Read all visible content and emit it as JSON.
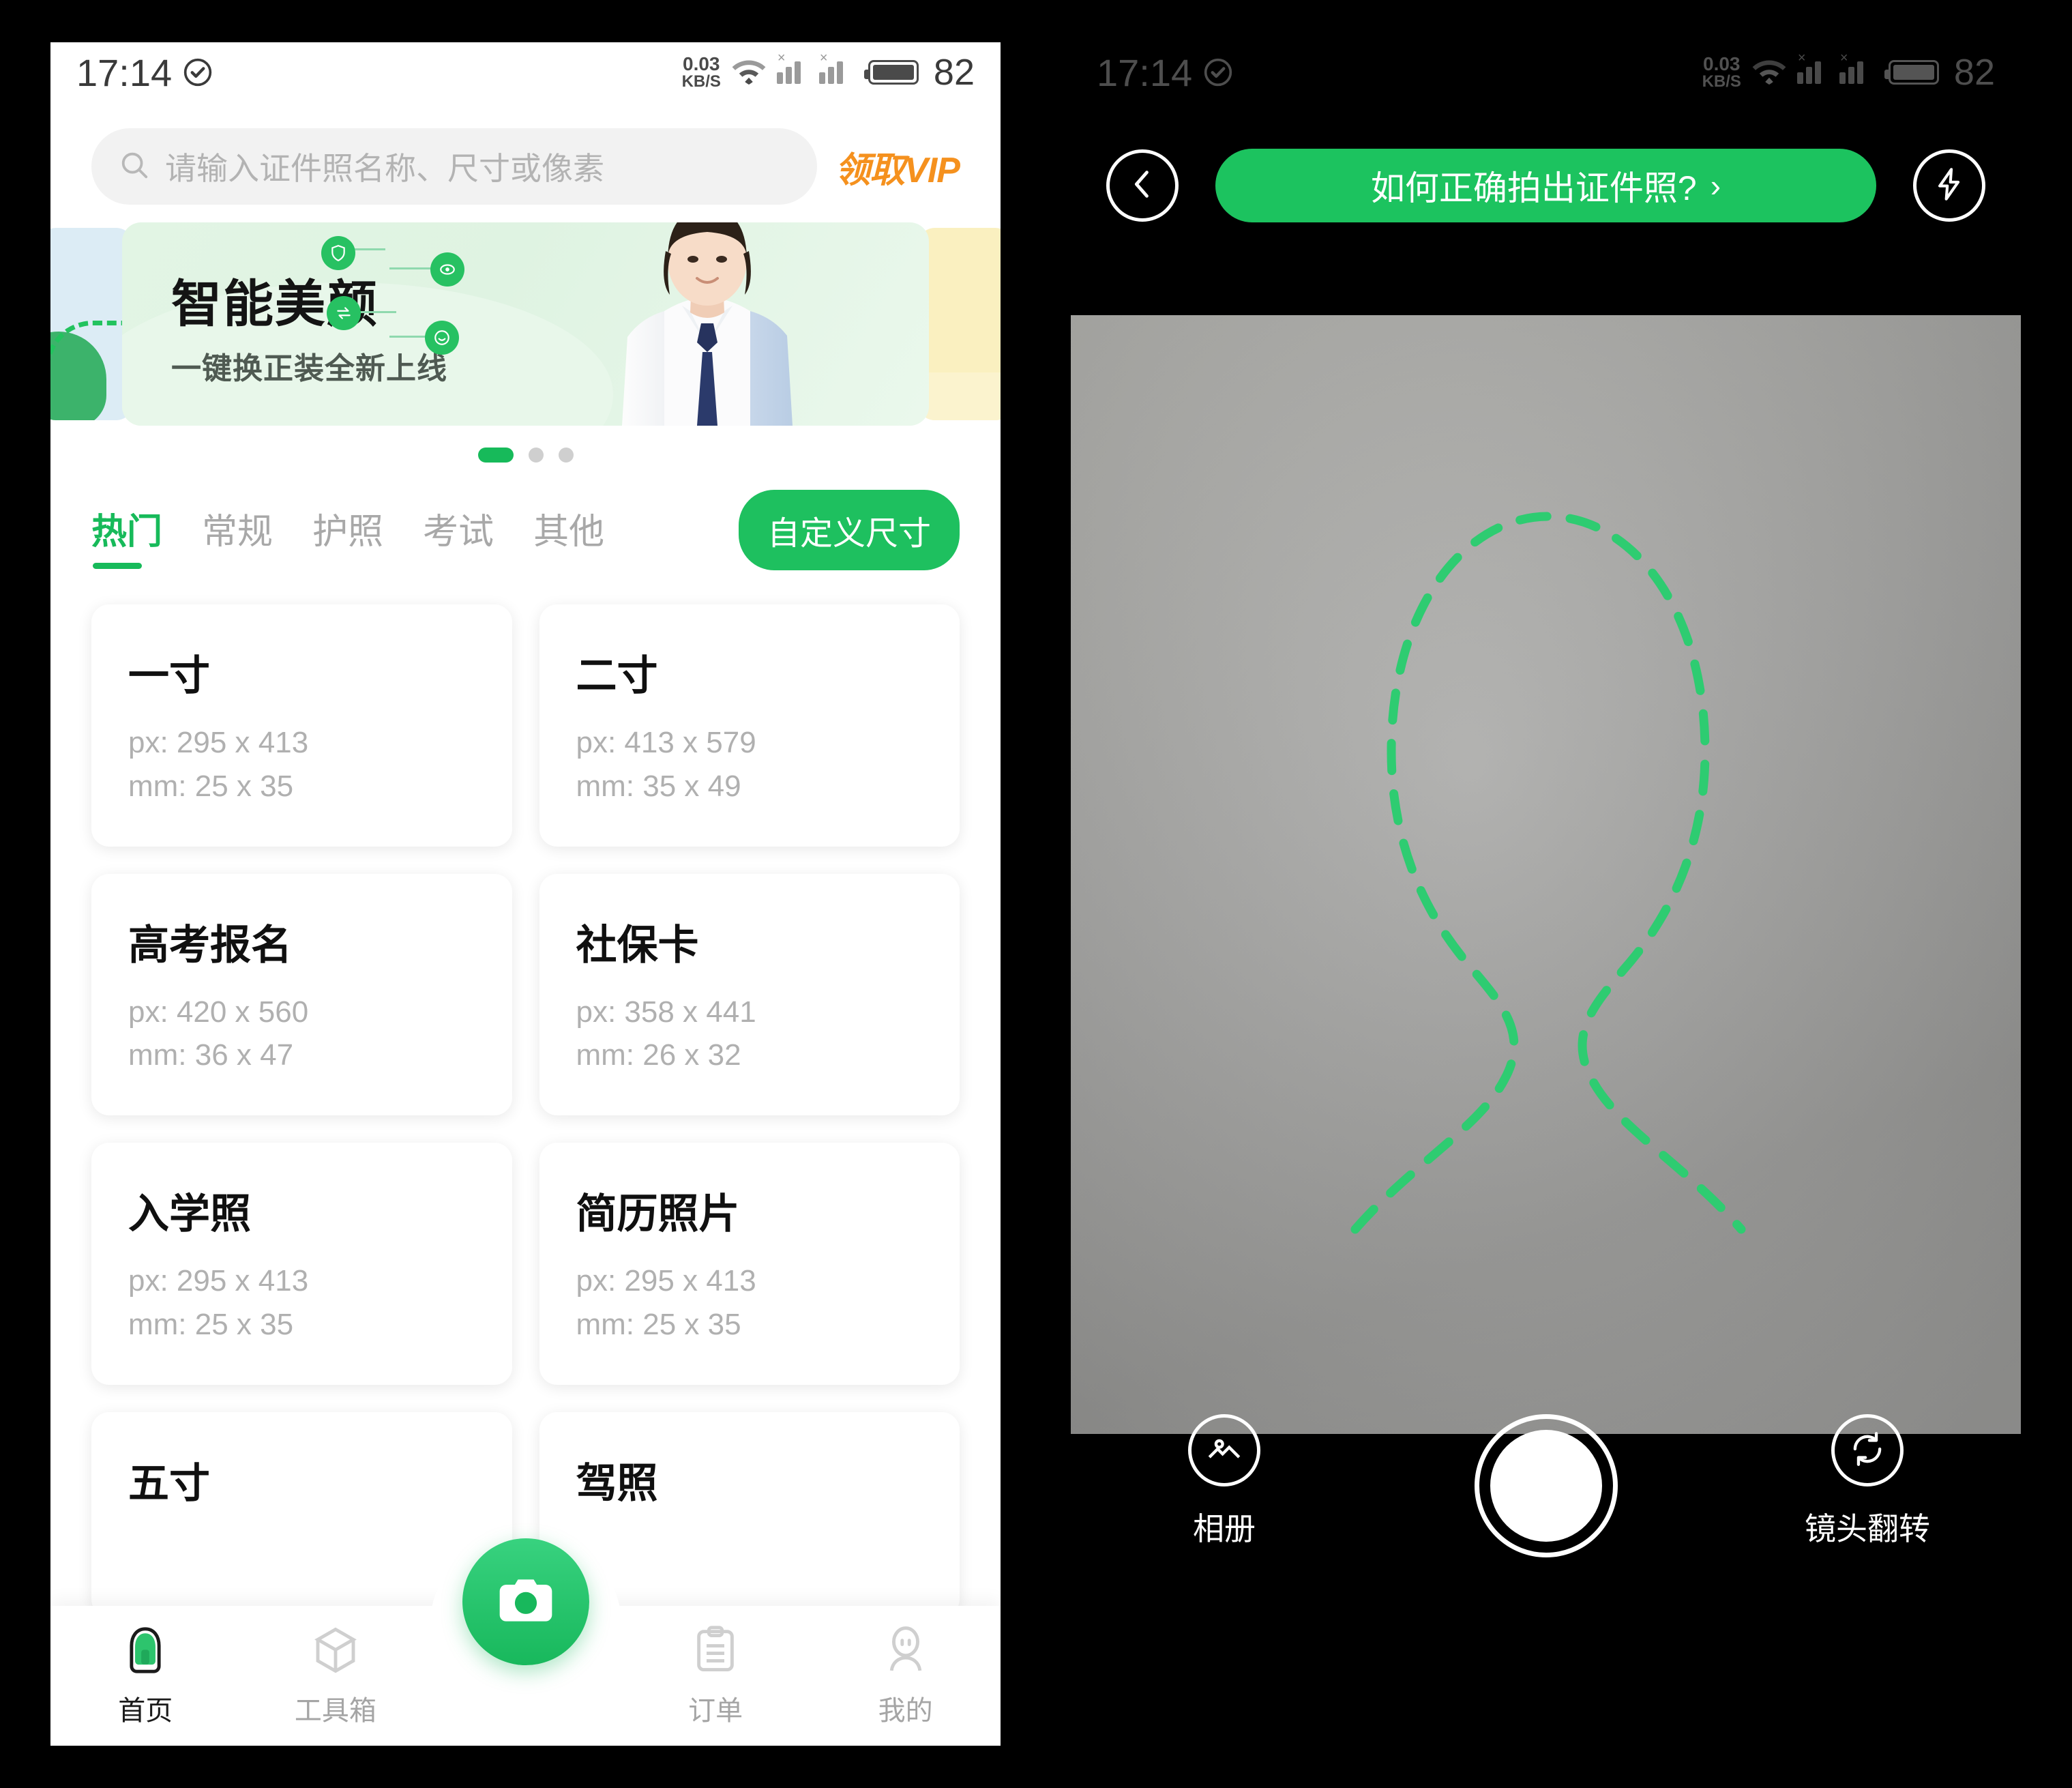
{
  "status_bar": {
    "time": "17:14",
    "net_speed_value": "0.03",
    "net_speed_unit": "KB/S",
    "battery_percent": "82",
    "icons": [
      "check-circle-icon",
      "wifi-icon",
      "signal-bars-icon",
      "signal-bars-icon",
      "battery-icon"
    ]
  },
  "left_screen": {
    "search": {
      "placeholder": "请输入证件照名称、尺寸或像素",
      "icon": "search-icon"
    },
    "vip_label": "领取VIP",
    "banner": {
      "title": "智能美颜",
      "subtitle": "一键换正装全新上线",
      "accent_color": "#27c162",
      "bg_color": "#e2f5e4",
      "peek_left_color": "#dcecf5",
      "peek_right_color": "#faf0c0"
    },
    "carousel": {
      "total": 3,
      "active_index": 0
    },
    "tabs": [
      {
        "label": "热门",
        "active": true
      },
      {
        "label": "常规",
        "active": false
      },
      {
        "label": "护照",
        "active": false
      },
      {
        "label": "考试",
        "active": false
      },
      {
        "label": "其他",
        "active": false
      }
    ],
    "custom_size_button": "自定义尺寸",
    "size_cards": [
      {
        "name": "一寸",
        "px": "px: 295 x 413",
        "mm": "mm: 25 x 35"
      },
      {
        "name": "二寸",
        "px": "px: 413 x 579",
        "mm": "mm: 35 x 49"
      },
      {
        "name": "高考报名",
        "px": "px: 420 x 560",
        "mm": "mm: 36 x 47"
      },
      {
        "name": "社保卡",
        "px": "px: 358 x 441",
        "mm": "mm: 26 x 32"
      },
      {
        "name": "入学照",
        "px": "px: 295 x 413",
        "mm": "mm: 25 x 35"
      },
      {
        "name": "简历照片",
        "px": "px: 295 x 413",
        "mm": "mm: 25 x 35"
      }
    ],
    "size_cards_partial": [
      {
        "name": "五寸"
      },
      {
        "name": "驾照"
      }
    ],
    "bottom_nav": [
      {
        "label": "首页",
        "icon": "home-icon",
        "active": true
      },
      {
        "label": "工具箱",
        "icon": "toolbox-icon",
        "active": false
      },
      {
        "label": "订单",
        "icon": "orders-icon",
        "active": false
      },
      {
        "label": "我的",
        "icon": "profile-icon",
        "active": false
      }
    ],
    "fab": {
      "icon": "camera-icon",
      "color": "#18b85c"
    }
  },
  "right_screen": {
    "back_icon": "chevron-left-icon",
    "flash_icon": "flash-icon",
    "tip_button": {
      "label": "如何正确拍出证件照?",
      "chevron": "›",
      "color": "#1cc35f"
    },
    "preview": {
      "overlay_icon": "person-silhouette-dashed",
      "overlay_color": "#2ecc71"
    },
    "controls": [
      {
        "label": "相册",
        "icon": "gallery-icon"
      },
      {
        "label": "",
        "icon": "shutter-icon"
      },
      {
        "label": "镜头翻转",
        "icon": "camera-flip-icon"
      }
    ]
  }
}
